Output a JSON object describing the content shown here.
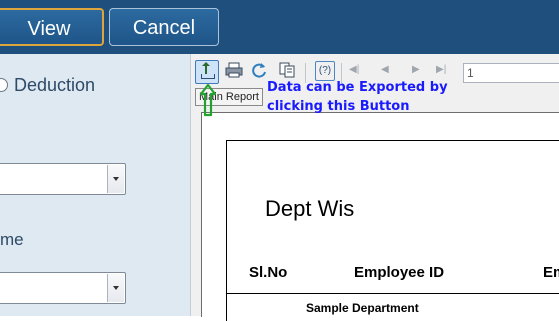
{
  "header": {
    "view_label": "View",
    "cancel_label": "Cancel"
  },
  "form": {
    "deduction_label": "Deduction",
    "field_label_partial": "me"
  },
  "viewer": {
    "tooltip": "Main Report",
    "help_label": "(?)",
    "page_number": "1",
    "annotation_line1": "Data can be Exported by",
    "annotation_line2": "clicking this Button"
  },
  "report": {
    "title": "Dept Wis",
    "columns": [
      "Sl.No",
      "Employee ID",
      "Em"
    ],
    "department": "Sample Department"
  },
  "colors": {
    "topbar": "#1f4f7d",
    "left_panel": "#dfe9f2",
    "annotation_text": "#1a1aff",
    "annotation_arrow": "#22a32e",
    "view_button_border": "#e0a43c"
  }
}
